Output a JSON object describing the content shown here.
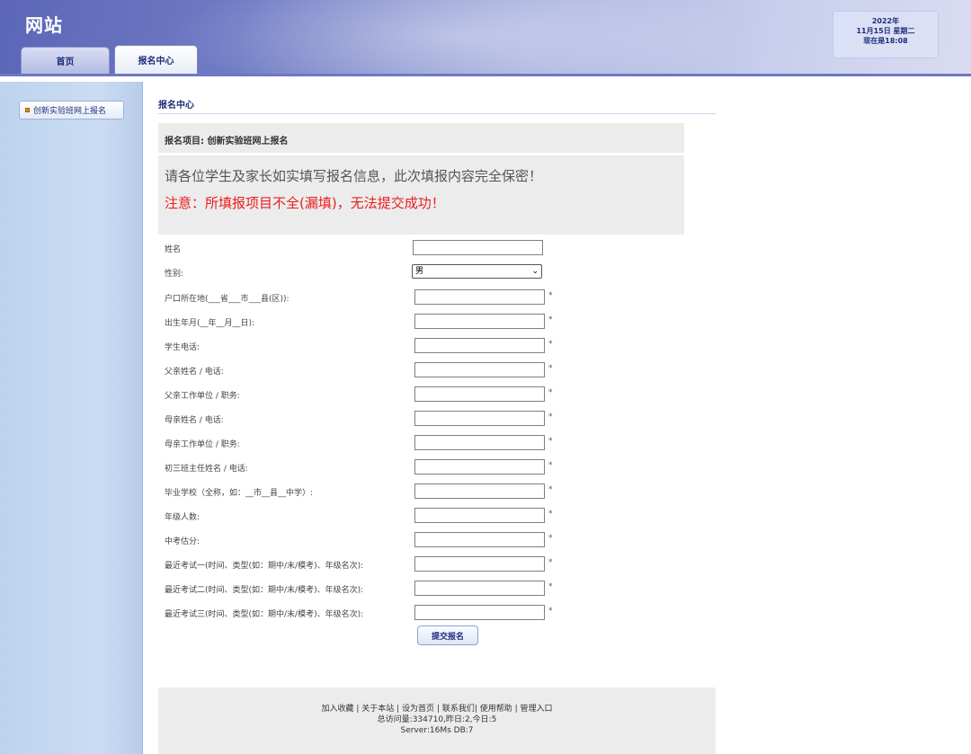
{
  "header": {
    "logo": "网站",
    "tabs": [
      {
        "label": "首页"
      },
      {
        "label": "报名中心"
      }
    ],
    "date": {
      "year": "2022年",
      "day": "11月15日 星期二",
      "time": "现在是18:08"
    }
  },
  "sidebar": {
    "items": [
      {
        "label": "创新实验班网上报名"
      }
    ]
  },
  "main": {
    "section_title": "报名中心",
    "project": "报名项目:  创新实验班网上报名",
    "notice_1": "请各位学生及家长如实填写报名信息，此次填报内容完全保密！",
    "notice_2": "注意：所填报项目不全(漏填)，无法提交成功！",
    "form": {
      "name_label": "姓名",
      "gender_label": "性别:",
      "gender_value": "男",
      "required_mark": "*",
      "fields": [
        {
          "label": "户口所在地(___省___市___县(区)):"
        },
        {
          "label": "出生年月(__年__月__日):"
        },
        {
          "label": "学生电话:"
        },
        {
          "label": "父亲姓名 / 电话:"
        },
        {
          "label": "父亲工作单位 / 职务:"
        },
        {
          "label": "母亲姓名 / 电话:"
        },
        {
          "label": "母亲工作单位 / 职务:"
        },
        {
          "label": "初三班主任姓名 / 电话:"
        },
        {
          "label": "毕业学校（全称，如：__市__县__中学）:"
        },
        {
          "label": "年级人数:"
        },
        {
          "label": "中考估分:"
        },
        {
          "label": "最近考试一(时间、类型(如：期中/末/模考)、年级名次):"
        },
        {
          "label": "最近考试二(时间、类型(如：期中/末/模考)、年级名次):"
        },
        {
          "label": "最近考试三(时间、类型(如：期中/末/模考)、年级名次):"
        }
      ],
      "submit_label": "提交报名"
    }
  },
  "footer": {
    "links": [
      "加入收藏",
      "关于本站",
      "设为首页",
      "联系我们",
      "使用帮助",
      "管理入口"
    ],
    "stats": "总访问量:334710,昨日:2,今日:5",
    "server": "Server:16Ms  DB:7"
  }
}
